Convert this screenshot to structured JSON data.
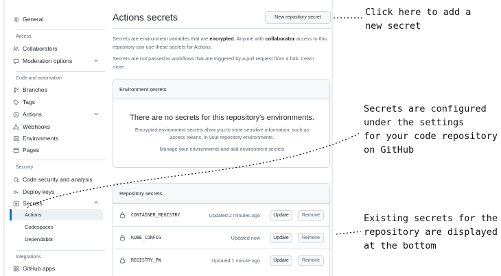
{
  "sidebar": {
    "general": "General",
    "access_label": "Access",
    "collaborators": "Collaborators",
    "moderation": "Moderation options",
    "code_label": "Code and automation",
    "branches": "Branches",
    "tags": "Tags",
    "actions": "Actions",
    "webhooks": "Webhooks",
    "environments": "Environments",
    "pages": "Pages",
    "security_label": "Security",
    "code_security": "Code security and analysis",
    "deploy_keys": "Deploy keys",
    "secrets": "Secrets",
    "sub_actions": "Actions",
    "sub_codespaces": "Codespaces",
    "sub_dependabot": "Dependabot",
    "integrations_label": "Integrations",
    "github_apps": "GitHub apps"
  },
  "main": {
    "title": "Actions secrets",
    "new_secret_button": "New repository secret",
    "desc1_a": "Secrets are environment variables that are ",
    "desc1_b": "encrypted",
    "desc1_c": ". Anyone with ",
    "desc1_d": "collaborator",
    "desc1_e": " access to this repository can use these secrets for Actions.",
    "desc2": "Secrets are not passed to workflows that are triggered by a pull request from a fork.",
    "learn_more": "Learn more."
  },
  "env_box": {
    "header": "Environment secrets",
    "blank_title": "There are no secrets for this repository's environments.",
    "blank_text": "Encrypted environment secrets allow you to store sensitive information, such as access tokens, in your repository environments.",
    "manage_link": "Manage your environments and add environment secrets"
  },
  "repo_box": {
    "header": "Repository secrets",
    "update_label": "Update",
    "remove_label": "Remove",
    "rows": [
      {
        "name": "CONTAINER_REGISTRY",
        "updated": "Updated 2 minutes ago"
      },
      {
        "name": "KUBE_CONFIG",
        "updated": "Updated now"
      },
      {
        "name": "REGISTRY_PW",
        "updated": "Updated 1 minute ago"
      }
    ]
  },
  "annotations": {
    "top": "Click here to add a\nnew secret",
    "middle": "Secrets are configured\nunder the settings\nfor your code repository\non GitHub",
    "bottom": "Existing secrets for the\nrepository are displayed\nat the bottom"
  },
  "colors": {
    "accent": "#0969da",
    "border": "#d0d7de",
    "muted": "#59636e"
  }
}
